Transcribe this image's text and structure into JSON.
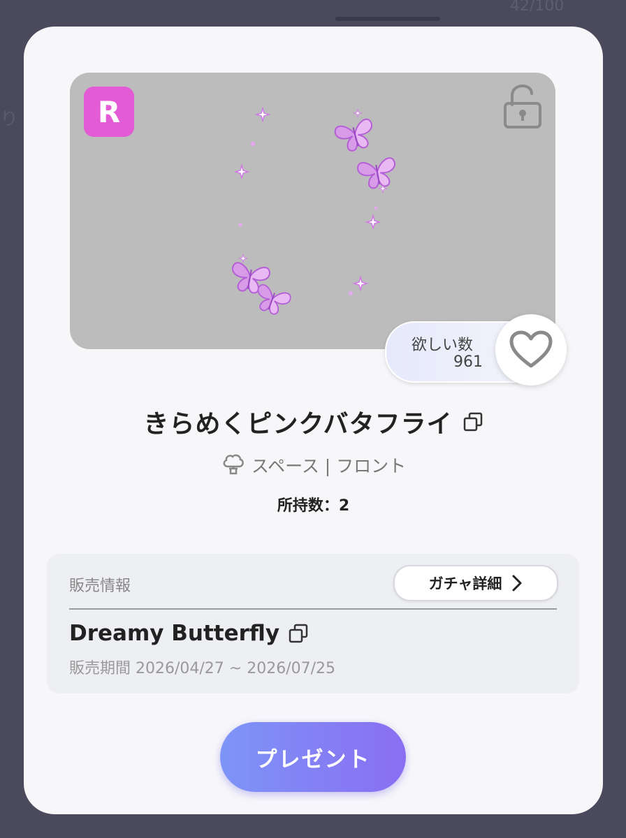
{
  "background": {
    "counter": "42/100",
    "edge_text": "り"
  },
  "item": {
    "rarity": "R",
    "title": "きらめくピンクバタフライ",
    "category": "スペース | フロント",
    "category_icon": "tree-icon",
    "owned": "所持数：2",
    "locked": false
  },
  "wishlist": {
    "label": "欲しい数",
    "count": "961",
    "icon": "heart-outline-icon"
  },
  "sales_info": {
    "label": "販売情報",
    "gacha_button": "ガチャ詳細",
    "gacha_name": "Dreamy Butterfly",
    "period": "販売期間 2026/04/27 ~ 2026/07/25"
  },
  "actions": {
    "present": "プレゼント"
  },
  "colors": {
    "rarity_badge": "#e45bd6",
    "preview_bg": "#bcbcbc",
    "button_gradient_start": "#7d95f7",
    "button_gradient_end": "#8a6ef2",
    "butterfly": "#c77ce0"
  }
}
